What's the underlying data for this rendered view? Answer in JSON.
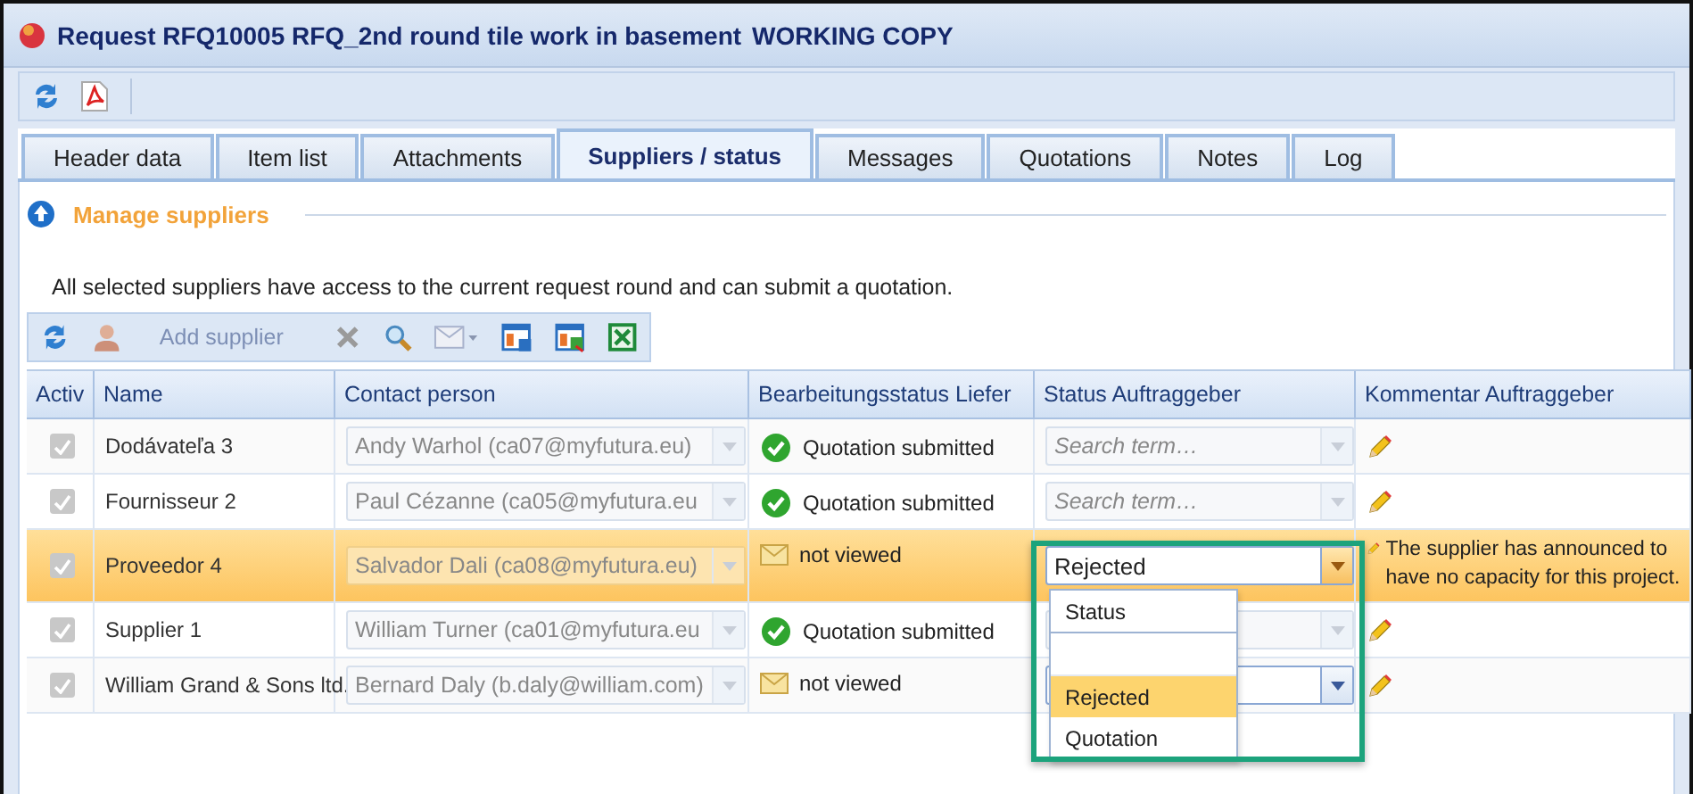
{
  "window": {
    "title": "Request RFQ10005 RFQ_2nd round tile work in basement",
    "badge": "WORKING COPY"
  },
  "tabs": [
    {
      "label": "Header data",
      "selected": false
    },
    {
      "label": "Item list",
      "selected": false
    },
    {
      "label": "Attachments",
      "selected": false
    },
    {
      "label": "Suppliers / status",
      "selected": true
    },
    {
      "label": "Messages",
      "selected": false
    },
    {
      "label": "Quotations",
      "selected": false
    },
    {
      "label": "Notes",
      "selected": false
    },
    {
      "label": "Log",
      "selected": false
    }
  ],
  "section": {
    "title": "Manage suppliers"
  },
  "info": "All selected suppliers have access to the current request round and can submit a quotation.",
  "grid_toolbar": {
    "add_label": "Add supplier"
  },
  "columns": [
    "Activ",
    "Name",
    "Contact person",
    "Bearbeitungsstatus Liefer",
    "Status Auftraggeber",
    "Kommentar Auftraggeber"
  ],
  "rows": [
    {
      "active": true,
      "selected": false,
      "name": "Dodávateľa 3",
      "contact": "Andy Warhol (ca07@myfutura.eu)",
      "supplier_status": {
        "kind": "submitted",
        "label": "Quotation submitted"
      },
      "client_status": {
        "disabled": true,
        "placeholder": "Search term…"
      }
    },
    {
      "active": true,
      "selected": false,
      "name": "Fournisseur 2",
      "contact": "Paul Cézanne (ca05@myfutura.eu",
      "supplier_status": {
        "kind": "submitted",
        "label": "Quotation submitted"
      },
      "client_status": {
        "disabled": true,
        "placeholder": "Search term…"
      }
    },
    {
      "active": true,
      "selected": true,
      "name": "Proveedor 4",
      "contact": "Salvador Dali (ca08@myfutura.eu)",
      "supplier_status": {
        "kind": "not_viewed",
        "label": "not viewed"
      },
      "client_status": {
        "disabled": false,
        "value": "Rejected",
        "open": true
      },
      "comment": "The supplier has announced to have no capacity for this project."
    },
    {
      "active": true,
      "selected": false,
      "name": "Supplier 1",
      "contact": "William Turner (ca01@myfutura.eu",
      "supplier_status": {
        "kind": "submitted",
        "label": "Quotation submitted"
      },
      "client_status": {
        "disabled": true
      }
    },
    {
      "active": true,
      "selected": false,
      "name": "William Grand & Sons ltd.",
      "contact": "Bernard Daly (b.daly@william.com)",
      "supplier_status": {
        "kind": "not_viewed",
        "label": "not viewed"
      },
      "client_status": {
        "disabled": false
      }
    }
  ],
  "dropdown": {
    "options": [
      {
        "kind": "option",
        "label": "Status",
        "selected": false
      },
      {
        "kind": "blank",
        "selected": false
      },
      {
        "kind": "option",
        "label": "Rejected",
        "selected": true
      },
      {
        "kind": "option",
        "label": "Quotation",
        "selected": false
      }
    ]
  }
}
